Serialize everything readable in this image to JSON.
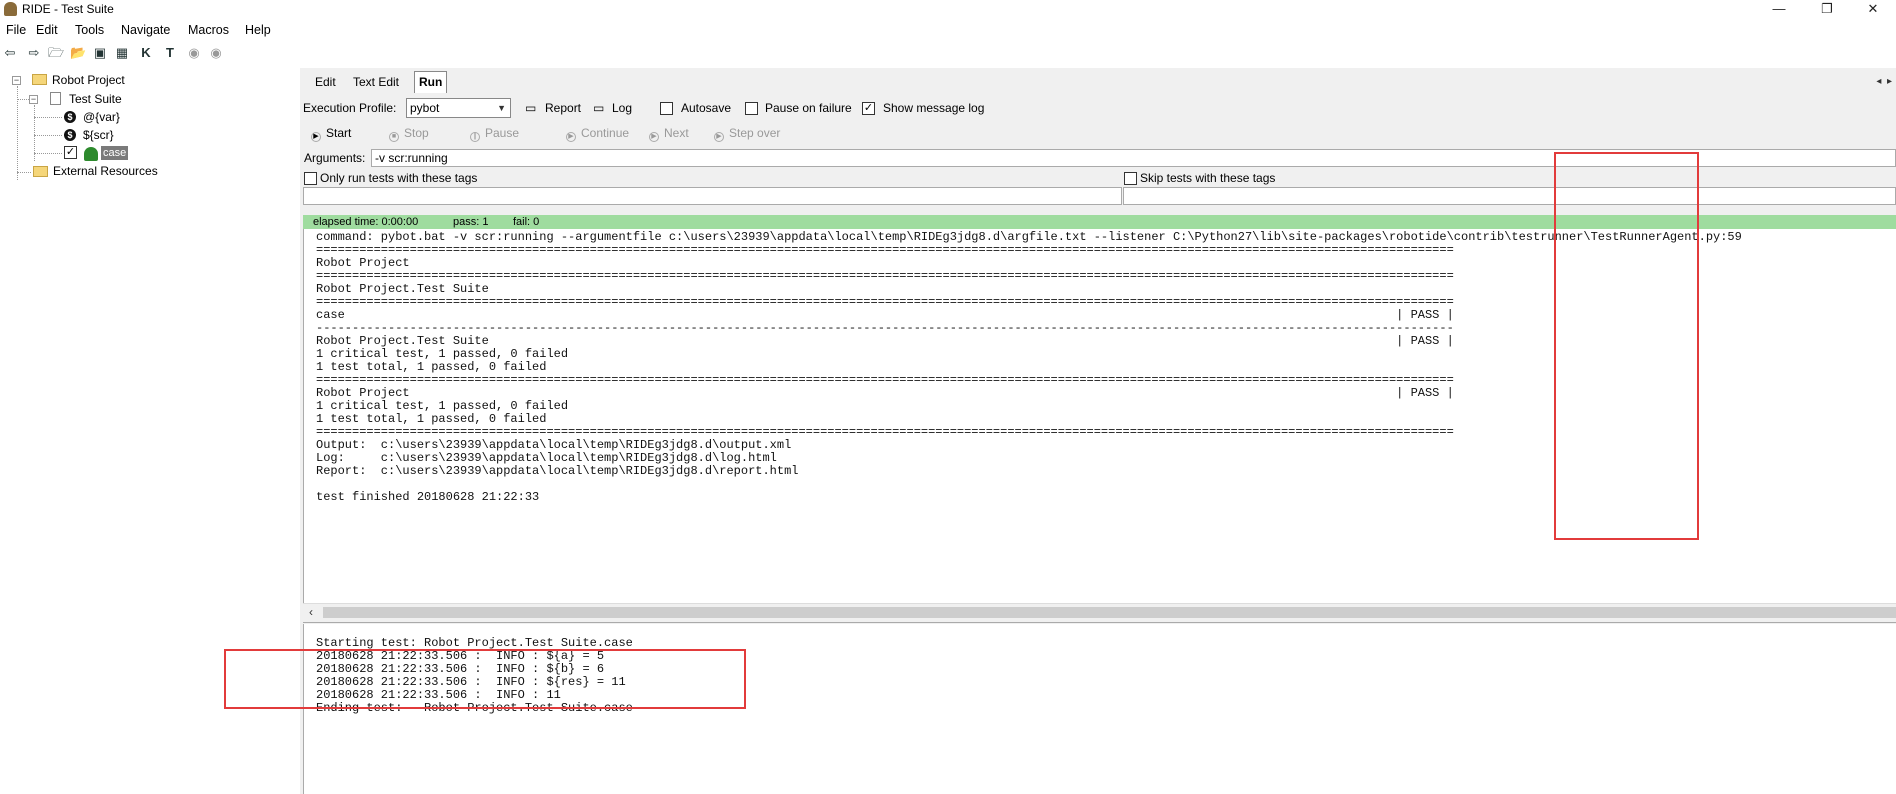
{
  "window": {
    "title": "RIDE - Test Suite"
  },
  "menu": [
    "File",
    "Edit",
    "Tools",
    "Navigate",
    "Macros",
    "Help"
  ],
  "tree": {
    "project": "Robot Project",
    "suite": "Test Suite",
    "var_list": "@{var}",
    "var_scalar": "${scr}",
    "test_case": "case",
    "external": "External Resources"
  },
  "tabs": [
    "Edit",
    "Text Edit",
    "Run"
  ],
  "run": {
    "execution_profile_label": "Execution Profile:",
    "profile_value": "pybot",
    "report_label": "Report",
    "log_label": "Log",
    "autosave_label": "Autosave",
    "pause_on_failure_label": "Pause on failure",
    "show_message_log_label": "Show message log",
    "buttons": {
      "start": "Start",
      "stop": "Stop",
      "pause": "Pause",
      "continue": "Continue",
      "next": "Next",
      "step_over": "Step over"
    },
    "arguments_label": "Arguments:",
    "arguments_value": "-v scr:running",
    "only_run_tags_label": "Only run tests with these tags",
    "skip_tags_label": "Skip tests with these tags",
    "status": {
      "elapsed": "elapsed time: 0:00:00",
      "pass": "pass: 1",
      "fail": "fail: 0",
      "color": "#9fdc9f"
    }
  },
  "console_output": "command: pybot.bat -v scr:running --argumentfile c:\\users\\23939\\appdata\\local\\temp\\RIDEg3jdg8.d\\argfile.txt --listener C:\\Python27\\lib\\site-packages\\robotide\\contrib\\testrunner\\TestRunnerAgent.py:59\n==============================================================================================================================================================\nRobot Project\n==============================================================================================================================================================\nRobot Project.Test Suite\n==============================================================================================================================================================\ncase                                                                                                                                                  | PASS |\n--------------------------------------------------------------------------------------------------------------------------------------------------------------\nRobot Project.Test Suite                                                                                                                              | PASS |\n1 critical test, 1 passed, 0 failed\n1 test total, 1 passed, 0 failed\n==============================================================================================================================================================\nRobot Project                                                                                                                                         | PASS |\n1 critical test, 1 passed, 0 failed\n1 test total, 1 passed, 0 failed\n==============================================================================================================================================================\nOutput:  c:\\users\\23939\\appdata\\local\\temp\\RIDEg3jdg8.d\\output.xml\nLog:     c:\\users\\23939\\appdata\\local\\temp\\RIDEg3jdg8.d\\log.html\nReport:  c:\\users\\23939\\appdata\\local\\temp\\RIDEg3jdg8.d\\report.html\n\ntest finished 20180628 21:22:33",
  "message_log": "Starting test: Robot Project.Test Suite.case\n20180628 21:22:33.506 :  INFO : ${a} = 5\n20180628 21:22:33.506 :  INFO : ${b} = 6\n20180628 21:22:33.506 :  INFO : ${res} = 11\n20180628 21:22:33.506 :  INFO : 11\nEnding test:   Robot Project.Test Suite.case",
  "colors": {
    "highlight": "#e23b3b",
    "status_pass": "#9fdc9f"
  },
  "icons": [
    "back-icon",
    "forward-icon",
    "open-directory-icon",
    "open-icon",
    "save-icon",
    "save-all-icon",
    "search-keywords-icon",
    "search-tests-icon",
    "play-icon",
    "stop-icon"
  ]
}
